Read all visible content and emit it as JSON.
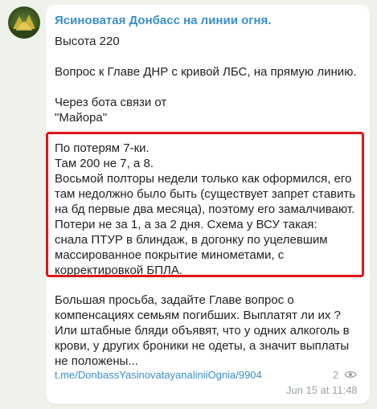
{
  "message": {
    "channel_name": "Ясиноватая Донбасс на линии огня.",
    "avatar_icon": "channel-avatar-icon",
    "lines_top": [
      "Высота 220",
      "Вопрос к Главе ДНР с кривой ЛБС, на прямую линию.",
      "Через бота связи от",
      "\"Майора\""
    ],
    "highlighted_lines": [
      "По потерям 7-ки.",
      "Там 200 не 7, а 8.",
      "Восьмой полторы недели только как оформился, его",
      "там недолжно было быть (существует запрет ставить",
      "на бд первые два месяца), поэтому его замалчивают.",
      "Потери не за 1, а за 2 дня. Схема у ВСУ такая:",
      "снала ПТУР в блиндаж, в догонку по уцелевшим",
      "массированное покрытие минометами, с",
      "корректировкой БПЛА."
    ],
    "lines_bottom": [
      "Большая просьба, задайте Главе вопрос о",
      "компенсациях семьям погибших. Выплатят ли их ?",
      "Или штабные бляди объявят, что у одних алкоголь в",
      "крови, у других броники не одеты, а значит выплаты",
      "не положены..."
    ],
    "link": "t.me/DonbassYasinovatayanaliniiOgnia/9904",
    "views": "2",
    "views_icon": "eye-icon",
    "timestamp": "Jun 15 at 11:48",
    "highlight_color": "#e0151a",
    "link_color": "#3a8fc8"
  }
}
